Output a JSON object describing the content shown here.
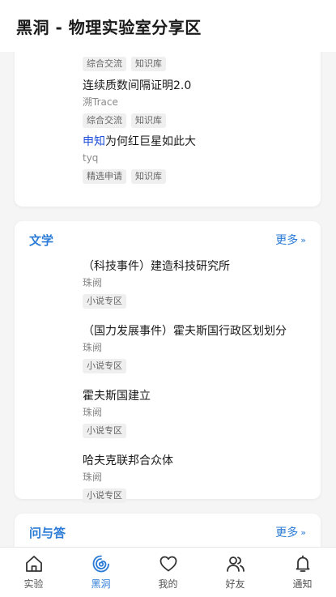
{
  "header": {
    "title": "黑洞 - 物理实验室分享区"
  },
  "card_top": {
    "posts": [
      {
        "prefix": "",
        "title": "",
        "author": "",
        "tags": [
          "综合交流",
          "知识库"
        ]
      },
      {
        "prefix": "",
        "title": "连续质数间隔证明2.0",
        "author": "溯Trace",
        "tags": [
          "综合交流",
          "知识库"
        ]
      },
      {
        "prefix": "申知",
        "title": "为何红巨星如此大",
        "author": "tyq",
        "tags": [
          "精选申请",
          "知识库"
        ]
      }
    ]
  },
  "card_literature": {
    "title": "文学",
    "more": "更多",
    "more_chevron": "»",
    "posts": [
      {
        "title": "（科技事件）建造科技研究所",
        "author": "珠阙",
        "tags": [
          "小说专区"
        ]
      },
      {
        "title": "（国力发展事件）霍夫斯国行政区划划分",
        "author": "珠阙",
        "tags": [
          "小说专区"
        ]
      },
      {
        "title": "霍夫斯国建立",
        "author": "珠阙",
        "tags": [
          "小说专区"
        ]
      },
      {
        "title": "哈夫克联邦合众体",
        "author": "珠阙",
        "tags": [
          "小说专区"
        ]
      }
    ]
  },
  "card_qa": {
    "title": "问与答",
    "more": "更多",
    "more_chevron": "»"
  },
  "nav": {
    "items": [
      {
        "label": "实验",
        "icon": "home-icon"
      },
      {
        "label": "黑洞",
        "icon": "blackhole-icon",
        "active": true
      },
      {
        "label": "我的",
        "icon": "heart-icon"
      },
      {
        "label": "好友",
        "icon": "friends-icon"
      },
      {
        "label": "通知",
        "icon": "bell-icon"
      }
    ]
  },
  "colors": {
    "accent": "#2a7ad6",
    "prefix": "#1e4fd8",
    "background": "#f5f5f5"
  }
}
